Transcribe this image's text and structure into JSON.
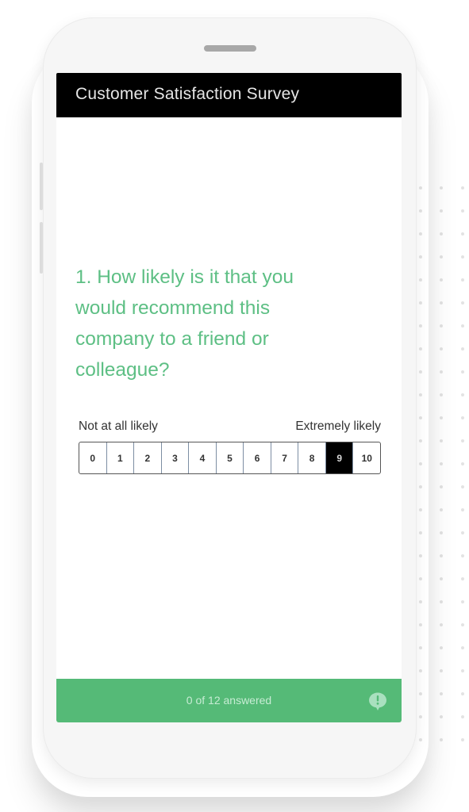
{
  "survey": {
    "title": "Customer Satisfaction Survey",
    "question": "1. How likely is it that you would recommend this company to a friend or colleague?",
    "scale": {
      "low_label": "Not at all likely",
      "high_label": "Extremely likely",
      "options": [
        "0",
        "1",
        "2",
        "3",
        "4",
        "5",
        "6",
        "7",
        "8",
        "9",
        "10"
      ],
      "selected": "9"
    }
  },
  "footer": {
    "progress_text": "0 of 12 answered",
    "feedback_icon": "feedback-speech-bubble-icon"
  },
  "colors": {
    "accent_green": "#55ba77",
    "question_green": "#5dbf84",
    "header_black": "#000000"
  }
}
